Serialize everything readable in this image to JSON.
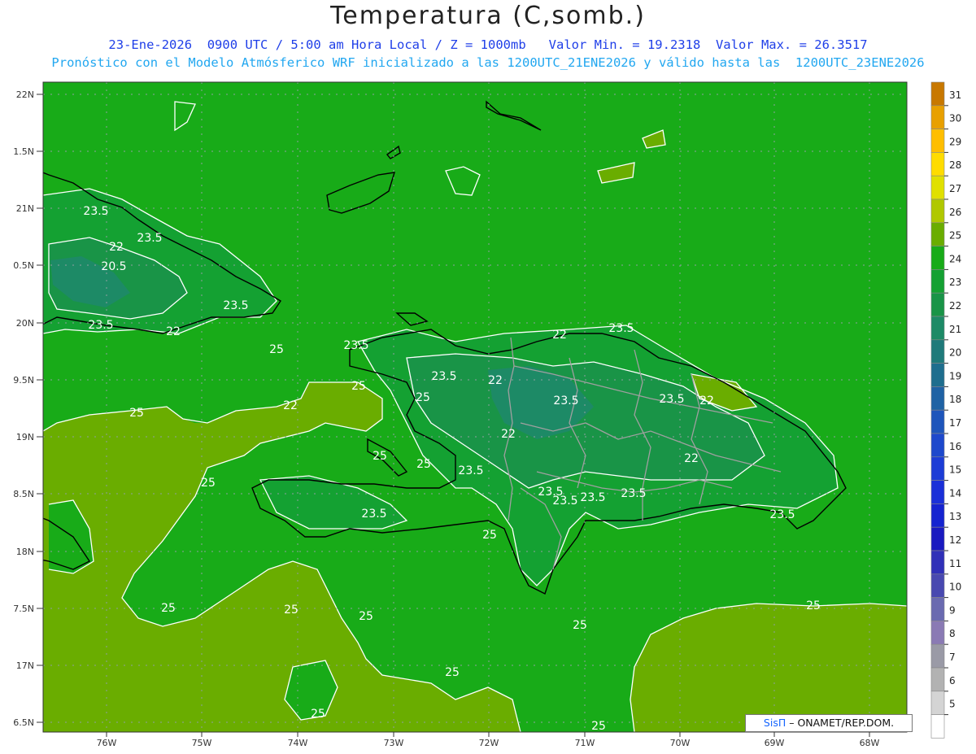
{
  "header": {
    "title": "Temperatura (C,somb.)",
    "line1": "23-Ene-2026  0900 UTC / 5:00 am Hora Local / Z = 1000mb   Valor Min. = 19.2318  Valor Max. = 26.3517",
    "line2": "Pronóstico con el Modelo Atmósferico WRF inicializado a las 1200UTC_21ENE2026 y válido hasta las  1200UTC_23ENE2026"
  },
  "map": {
    "lat_labels": [
      "22N",
      "1.5N",
      "21N",
      "0.5N",
      "20N",
      "9.5N",
      "19N",
      "8.5N",
      "18N",
      "7.5N",
      "17N",
      "6.5N"
    ],
    "lon_labels": [
      "76W",
      "75W",
      "74W",
      "73W",
      "72W",
      "71W",
      "70W",
      "69W",
      "68W"
    ],
    "contour_labels": [
      "23.5",
      "22",
      "23.5",
      "20.5",
      "23.5",
      "22",
      "23.5",
      "25",
      "23.5",
      "25",
      "25",
      "23.5",
      "22",
      "22",
      "23.5",
      "22",
      "23.5",
      "23.5",
      "22",
      "22",
      "23.5",
      "22",
      "25",
      "25",
      "23.5",
      "25",
      "23.5",
      "23.5",
      "23.5",
      "23.5",
      "23.5",
      "25",
      "25",
      "25",
      "25",
      "25",
      "25",
      "25",
      "25",
      "25",
      "25"
    ],
    "colors": {
      "warm_25": "#6aad00",
      "band_24": "#18ab18",
      "band_23": "#14a132",
      "band_22": "#199447",
      "band_21": "#1d8a66",
      "contour": "#ffffff",
      "coast": "#000000",
      "border": "#a0a0a0"
    }
  },
  "colorbar": {
    "labels": [
      "31",
      "30",
      "29",
      "28",
      "27",
      "26",
      "25",
      "24",
      "23",
      "22",
      "21",
      "20",
      "19",
      "18",
      "17",
      "16",
      "15",
      "14",
      "13",
      "12",
      "11",
      "10",
      "9",
      "8",
      "7",
      "6",
      "5"
    ],
    "colors": [
      "#c87800",
      "#e8a000",
      "#ffbe00",
      "#ffdc00",
      "#e0e000",
      "#b0c800",
      "#6aad00",
      "#18ab18",
      "#14a132",
      "#199447",
      "#1d8a66",
      "#1f7a7a",
      "#1f6e8e",
      "#1f62a4",
      "#1e55bb",
      "#1d48cc",
      "#1c3cd6",
      "#1a2fd8",
      "#1523d0",
      "#1a1ac0",
      "#3030b8",
      "#4848b0",
      "#6a6ab0",
      "#8a7ab4",
      "#9a9aa6",
      "#b2b2b2",
      "#d4d4d4",
      "#ffffff"
    ]
  },
  "credit": {
    "sis": "SisΠ",
    "text": "– ONAMET/REP.DOM."
  }
}
